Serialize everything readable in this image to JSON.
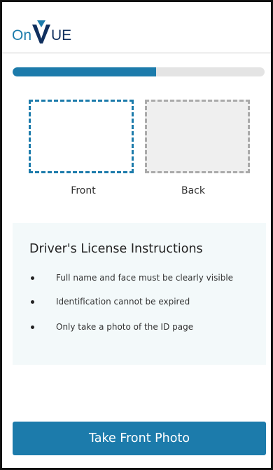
{
  "brand": {
    "logo_prefix": "On",
    "logo_mark": "V",
    "logo_suffix": "UE",
    "colors": {
      "blue": "#1c7bab",
      "navy": "#0f2f5e"
    }
  },
  "progress": {
    "fraction": 0.57
  },
  "id_capture": {
    "front_label": "Front",
    "back_label": "Back"
  },
  "instructions": {
    "title": "Driver's License Instructions",
    "items": [
      "Full name and face must be clearly visible",
      "Identification cannot be expired",
      "Only take a photo of the ID page"
    ]
  },
  "actions": {
    "take_photo_label": "Take Front Photo"
  }
}
